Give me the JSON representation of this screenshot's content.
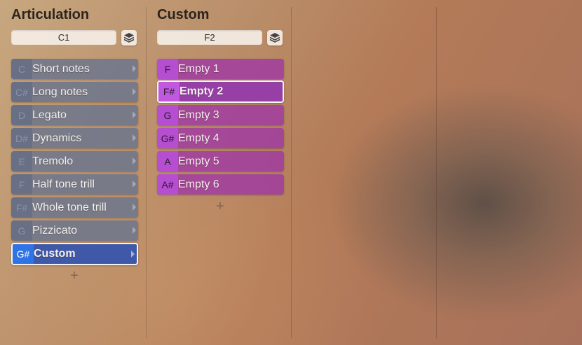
{
  "articulation": {
    "title": "Articulation",
    "key_value": "C1",
    "layer_icon": "layers-icon",
    "add_icon": "plus-icon",
    "items": [
      {
        "key": "C",
        "label": "Short notes"
      },
      {
        "key": "C#",
        "label": "Long notes"
      },
      {
        "key": "D",
        "label": "Legato"
      },
      {
        "key": "D#",
        "label": "Dynamics"
      },
      {
        "key": "E",
        "label": "Tremolo"
      },
      {
        "key": "F",
        "label": "Half tone trill"
      },
      {
        "key": "F#",
        "label": "Whole tone trill"
      },
      {
        "key": "G",
        "label": "Pizzicato"
      },
      {
        "key": "G#",
        "label": "Custom",
        "selected": true
      }
    ]
  },
  "custom": {
    "title": "Custom",
    "key_value": "F2",
    "layer_icon": "layers-icon",
    "add_icon": "plus-icon",
    "items": [
      {
        "key": "F",
        "label": "Empty 1"
      },
      {
        "key": "F#",
        "label": "Empty 2",
        "selected": true
      },
      {
        "key": "G",
        "label": "Empty 3"
      },
      {
        "key": "G#",
        "label": "Empty 4"
      },
      {
        "key": "A",
        "label": "Empty 5"
      },
      {
        "key": "A#",
        "label": "Empty 6"
      }
    ]
  },
  "colors": {
    "articulation_item": "#6e768c",
    "articulation_selected": "#3f58a8",
    "articulation_selected_key": "#2f73e6",
    "custom_item": "#a03ca0",
    "custom_key": "#b64ed2",
    "selection_outline": "#f4f4f4"
  }
}
